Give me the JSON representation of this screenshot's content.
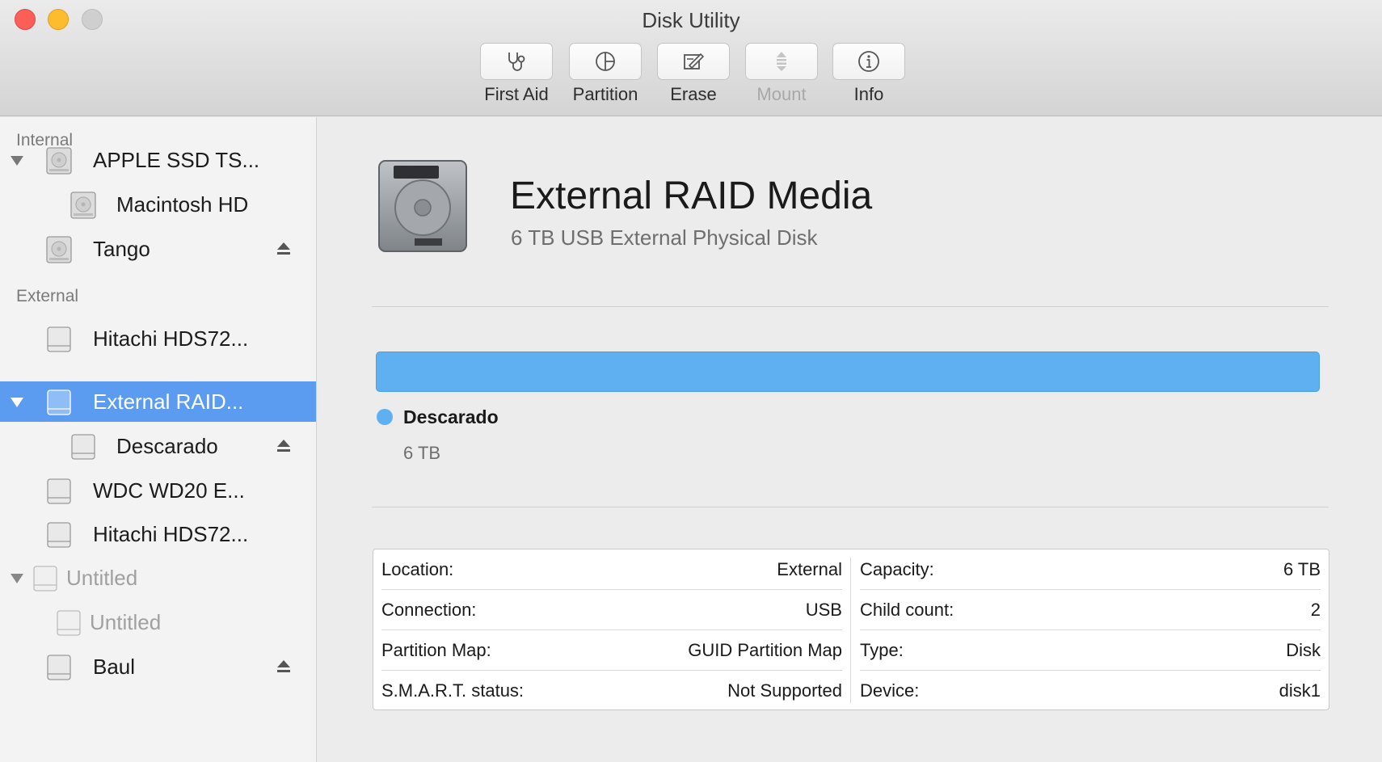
{
  "window": {
    "title": "Disk Utility"
  },
  "toolbar": {
    "buttons": [
      {
        "label": "First Aid",
        "icon": "stethoscope-icon",
        "enabled": true
      },
      {
        "label": "Partition",
        "icon": "pie-chart-icon",
        "enabled": true
      },
      {
        "label": "Erase",
        "icon": "erase-icon",
        "enabled": true
      },
      {
        "label": "Mount",
        "icon": "mount-icon",
        "enabled": false
      },
      {
        "label": "Info",
        "icon": "info-icon",
        "enabled": true
      }
    ]
  },
  "sidebar": {
    "internal_header": "Internal",
    "external_header": "External",
    "items": [
      {
        "label": "APPLE SSD TS...",
        "expanded": true,
        "ejectable": false
      },
      {
        "label": "Macintosh HD",
        "ejectable": false
      },
      {
        "label": "Tango",
        "ejectable": true
      },
      {
        "label": "Hitachi HDS72...",
        "ejectable": false
      },
      {
        "label": "External RAID...",
        "expanded": true,
        "selected": true
      },
      {
        "label": "Descarado",
        "ejectable": true
      },
      {
        "label": "WDC WD20 E...",
        "ejectable": false
      },
      {
        "label": "Hitachi HDS72...",
        "ejectable": false
      },
      {
        "label": "Untitled",
        "expanded": true,
        "dimmed": true
      },
      {
        "label": "Untitled",
        "dimmed": true
      },
      {
        "label": "Baul",
        "ejectable": true
      }
    ]
  },
  "detail": {
    "name": "External RAID Media",
    "subtitle": "6 TB USB External Physical Disk",
    "partition": {
      "name": "Descarado",
      "size": "6 TB",
      "color": "#5fb0f0",
      "fraction": 1.0
    },
    "info_left": [
      {
        "key": "Location:",
        "value": "External"
      },
      {
        "key": "Connection:",
        "value": "USB"
      },
      {
        "key": "Partition Map:",
        "value": "GUID Partition Map"
      },
      {
        "key": "S.M.A.R.T. status:",
        "value": "Not Supported"
      }
    ],
    "info_right": [
      {
        "key": "Capacity:",
        "value": "6 TB"
      },
      {
        "key": "Child count:",
        "value": "2"
      },
      {
        "key": "Type:",
        "value": "Disk"
      },
      {
        "key": "Device:",
        "value": "disk1"
      }
    ]
  },
  "colors": {
    "selection": "#5b9cf0",
    "partition": "#5fb0f0"
  }
}
